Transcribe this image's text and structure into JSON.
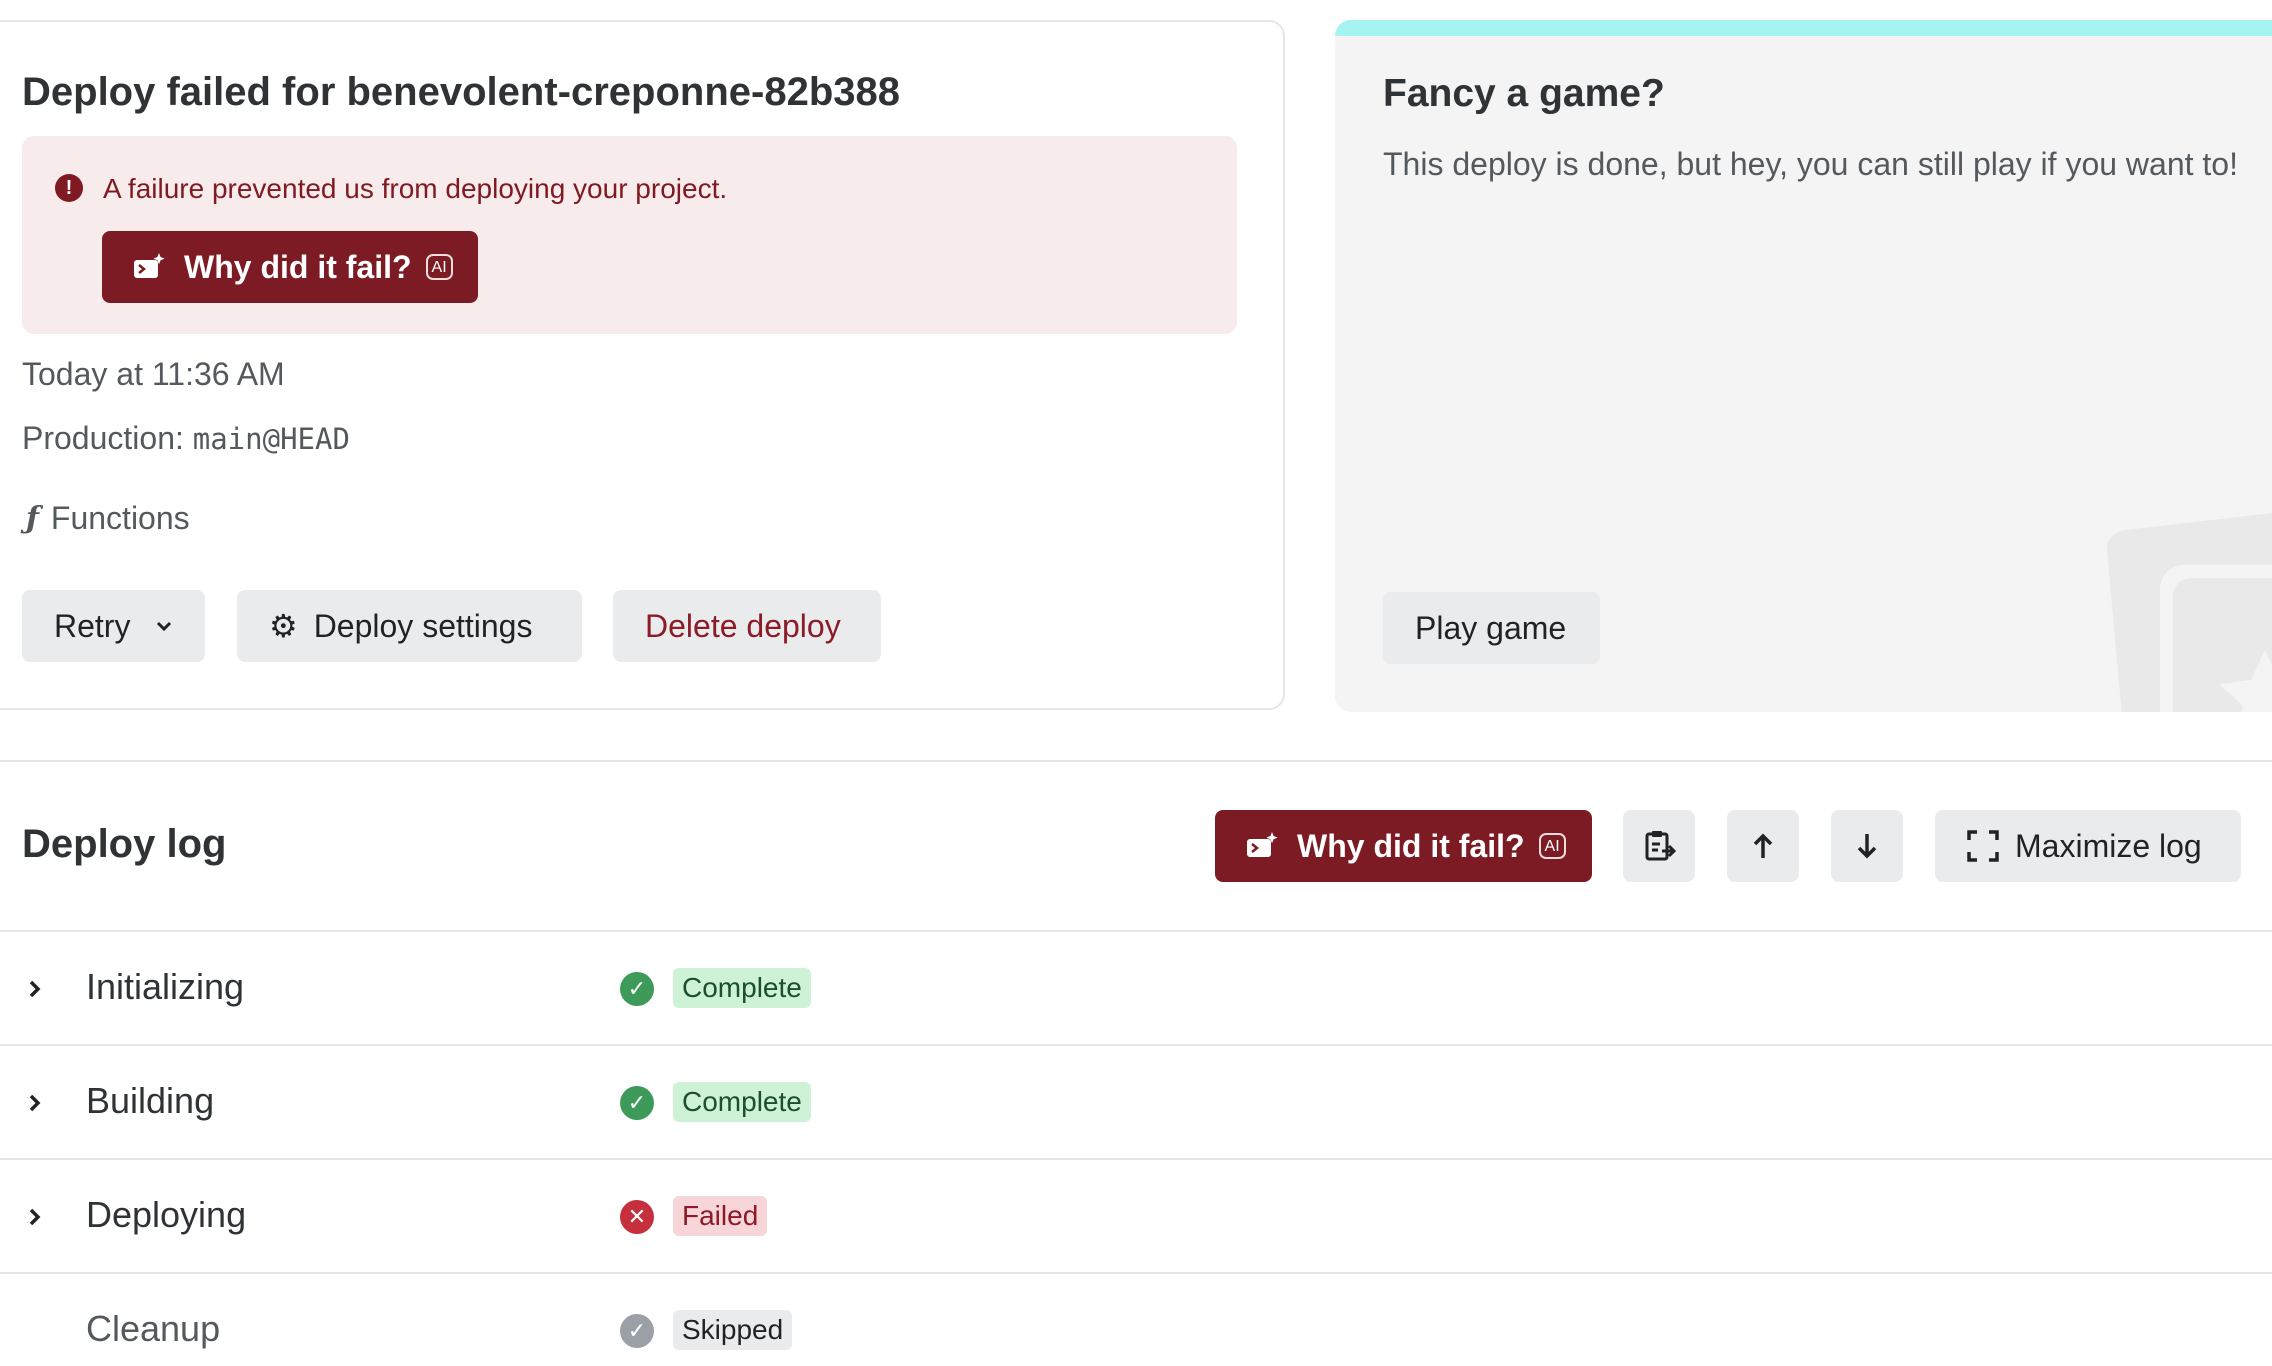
{
  "summary": {
    "title": "Deploy failed for benevolent-creponne-82b388",
    "alert_text": "A failure prevented us from deploying your project.",
    "ai_button_label": "Why did it fail?",
    "ai_badge": "AI",
    "timestamp": "Today at 11:36 AM",
    "branch_prefix": "Production: ",
    "branch": "main@HEAD",
    "functions_label": "Functions",
    "retry_label": "Retry",
    "settings_label": "Deploy settings",
    "delete_label": "Delete deploy"
  },
  "game": {
    "title": "Fancy a game?",
    "description": "This deploy is done, but hey, you can still play if you want to!",
    "play_label": "Play game"
  },
  "log": {
    "title": "Deploy log",
    "ai_button_label": "Why did it fail?",
    "ai_badge": "AI",
    "maximize_label": "Maximize log",
    "rows": [
      {
        "label": "Initializing",
        "status": "Complete"
      },
      {
        "label": "Building",
        "status": "Complete"
      },
      {
        "label": "Deploying",
        "status": "Failed"
      },
      {
        "label": "Cleanup",
        "status": "Skipped"
      }
    ]
  },
  "colors": {
    "accent_dark_red": "#7c1b24",
    "alert_bg": "#f8ebeb",
    "complete_green": "#3d9a58",
    "failed_red": "#c6303c",
    "game_stripe": "#a6f4f2"
  },
  "icons": [
    "error-icon",
    "ai-spark-icon",
    "functions-icon",
    "chevron-down-icon",
    "gear-icon",
    "copy-log-icon",
    "arrow-up-icon",
    "arrow-down-icon",
    "maximize-icon",
    "chevron-right-icon",
    "check-circle-icon",
    "x-circle-icon"
  ]
}
